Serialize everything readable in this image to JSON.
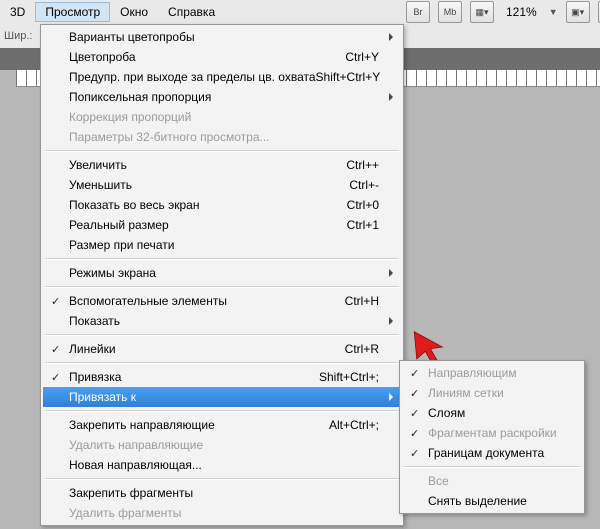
{
  "menubar": {
    "items": [
      "3D",
      "Просмотр",
      "Окно",
      "Справка"
    ],
    "openIndex": 1
  },
  "toolbar": {
    "zoom": "121%"
  },
  "optionsPrefix": "Шир.:",
  "menu": [
    {
      "t": "item",
      "label": "Варианты цветопробы",
      "submenu": true
    },
    {
      "t": "item",
      "label": "Цветопроба",
      "shortcut": "Ctrl+Y"
    },
    {
      "t": "item",
      "label": "Предупр. при выходе за пределы цв. охвата",
      "shortcut": "Shift+Ctrl+Y"
    },
    {
      "t": "item",
      "label": "Попиксельная пропорция",
      "submenu": true
    },
    {
      "t": "item",
      "label": "Коррекция пропорций",
      "disabled": true
    },
    {
      "t": "item",
      "label": "Параметры 32-битного просмотра...",
      "disabled": true
    },
    {
      "t": "sep"
    },
    {
      "t": "item",
      "label": "Увеличить",
      "shortcut": "Ctrl++"
    },
    {
      "t": "item",
      "label": "Уменьшить",
      "shortcut": "Ctrl+-"
    },
    {
      "t": "item",
      "label": "Показать во весь экран",
      "shortcut": "Ctrl+0"
    },
    {
      "t": "item",
      "label": "Реальный размер",
      "shortcut": "Ctrl+1"
    },
    {
      "t": "item",
      "label": "Размер при печати"
    },
    {
      "t": "sep"
    },
    {
      "t": "item",
      "label": "Режимы экрана",
      "submenu": true
    },
    {
      "t": "sep"
    },
    {
      "t": "item",
      "label": "Вспомогательные элементы",
      "shortcut": "Ctrl+H",
      "check": true
    },
    {
      "t": "item",
      "label": "Показать",
      "submenu": true
    },
    {
      "t": "sep"
    },
    {
      "t": "item",
      "label": "Линейки",
      "shortcut": "Ctrl+R",
      "check": true
    },
    {
      "t": "sep"
    },
    {
      "t": "item",
      "label": "Привязка",
      "shortcut": "Shift+Ctrl+;",
      "check": true
    },
    {
      "t": "item",
      "label": "Привязать к",
      "submenu": true,
      "highlight": true
    },
    {
      "t": "sep"
    },
    {
      "t": "item",
      "label": "Закрепить направляющие",
      "shortcut": "Alt+Ctrl+;"
    },
    {
      "t": "item",
      "label": "Удалить направляющие",
      "disabled": true
    },
    {
      "t": "item",
      "label": "Новая направляющая..."
    },
    {
      "t": "sep"
    },
    {
      "t": "item",
      "label": "Закрепить фрагменты"
    },
    {
      "t": "item",
      "label": "Удалить фрагменты",
      "disabled": true
    }
  ],
  "submenu": [
    {
      "t": "item",
      "label": "Направляющим",
      "check": true,
      "disabled": true
    },
    {
      "t": "item",
      "label": "Линиям сетки",
      "check": true,
      "disabled": true
    },
    {
      "t": "item",
      "label": "Слоям",
      "check": true
    },
    {
      "t": "item",
      "label": "Фрагментам раскройки",
      "check": true,
      "disabled": true
    },
    {
      "t": "item",
      "label": "Границам документа",
      "check": true
    },
    {
      "t": "sep"
    },
    {
      "t": "item",
      "label": "Все",
      "disabled": true
    },
    {
      "t": "item",
      "label": "Снять выделение"
    }
  ]
}
